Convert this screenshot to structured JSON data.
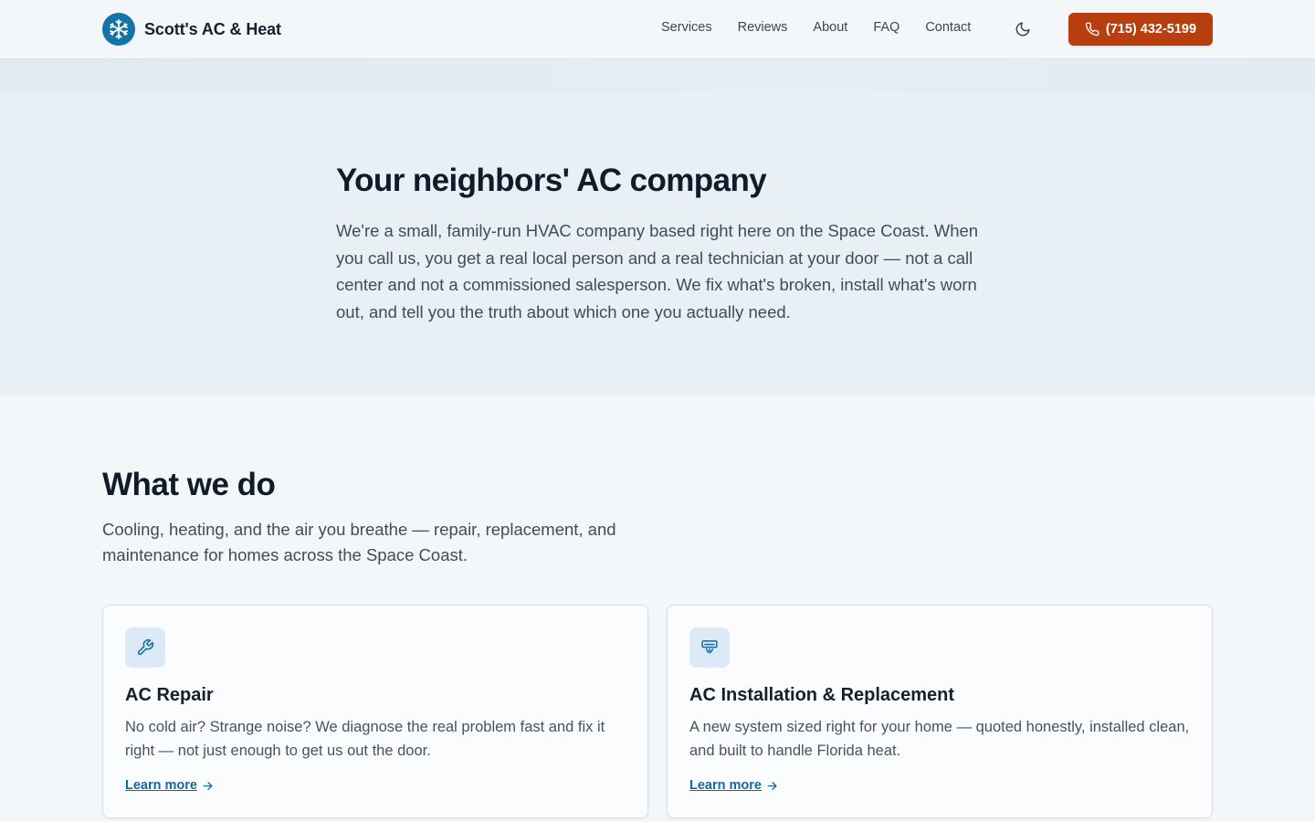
{
  "header": {
    "brand_name": "Scott's AC & Heat",
    "logo_icon": "snowflake-icon",
    "nav": [
      "Services",
      "Reviews",
      "About",
      "FAQ",
      "Contact"
    ],
    "theme_icon": "moon-icon",
    "phone_label": "(715) 432-5199",
    "phone_icon": "phone-icon"
  },
  "hero": {
    "title": "Your neighbors' AC company",
    "body": "We're a small, family-run HVAC company based right here on the Space Coast. When you call us, you get a real local person and a real technician at your door — not a call center and not a commissioned salesperson. We fix what's broken, install what's worn out, and tell you the truth about which one you actually need."
  },
  "services": {
    "title": "What we do",
    "subtitle": "Cooling, heating, and the air you breathe — repair, replacement, and maintenance for homes across the Space Coast.",
    "cards": [
      {
        "icon": "wrench-icon",
        "title": "AC Repair",
        "body": "No cold air? Strange noise? We diagnose the real problem fast and fix it right — not just enough to get us out the door.",
        "link": "Learn more"
      },
      {
        "icon": "air-conditioner-icon",
        "title": "AC Installation & Replacement",
        "body": "A new system sized right for your home — quoted honestly, installed clean, and built to handle Florida heat.",
        "link": "Learn more"
      }
    ]
  },
  "colors": {
    "accent": "#b93e0f",
    "brand_blue": "#1673a8",
    "link": "#146a9f"
  }
}
